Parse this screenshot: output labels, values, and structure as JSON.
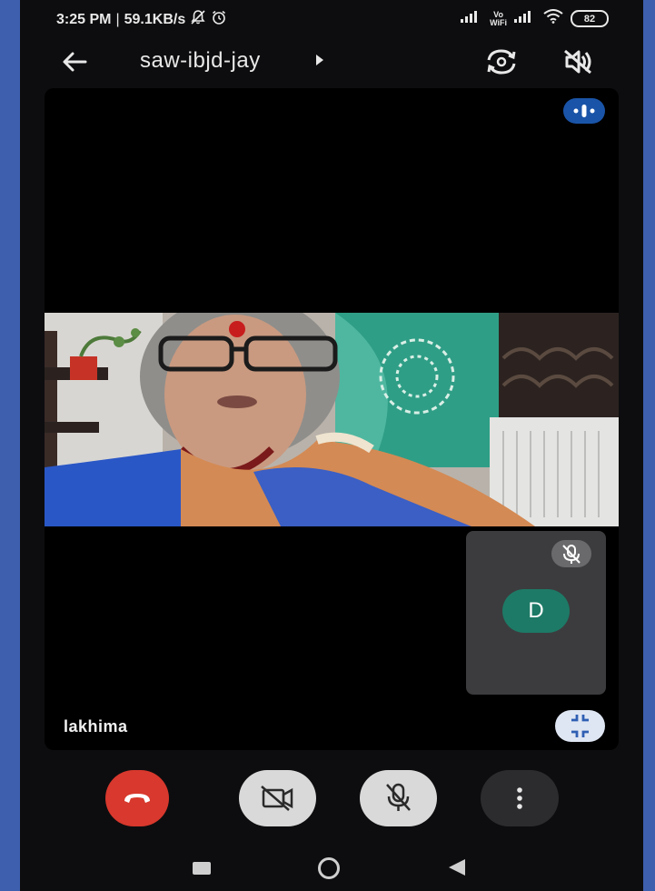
{
  "status_bar": {
    "time": "3:25 PM",
    "separator": "|",
    "speed": "59.1KB/s",
    "vowifi_top": "Vo",
    "vowifi_bottom": "WiFi",
    "battery": "82",
    "icons": [
      "notifications-off-icon",
      "alarm-icon",
      "signal-icon",
      "vowifi-icon",
      "signal-icon",
      "wifi-icon",
      "battery-icon"
    ]
  },
  "top_bar": {
    "meeting_code": "saw-ibjd-jay",
    "icons": [
      "back-arrow-icon",
      "caret-right-icon",
      "switch-camera-icon",
      "speaker-off-icon"
    ]
  },
  "main_tile": {
    "participant_name": "lakhima",
    "self_avatar_letter": "D",
    "icons": [
      "audio-indicator-icon",
      "mic-off-icon",
      "minimize-icon"
    ]
  },
  "controls": {
    "icons": [
      "end-call-icon",
      "camera-off-icon",
      "mic-off-icon",
      "more-vert-icon"
    ],
    "colors": {
      "end_call": "#d8382d",
      "toggle": "#d9d9d9",
      "more": "#2c2c2e",
      "avatar": "#1d7a66",
      "accent": "#1a54a8"
    }
  },
  "nav_bar": {
    "icons": [
      "recents-icon",
      "home-icon",
      "back-icon"
    ]
  }
}
